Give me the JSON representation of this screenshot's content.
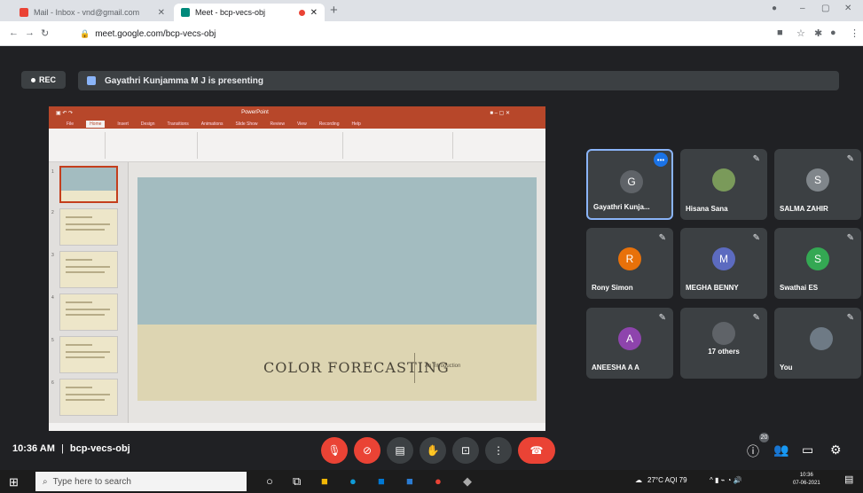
{
  "browser": {
    "tab_inactive": "Mail - Inbox - vnd@gmail.com",
    "tab_active": "Meet - bcp-vecs-obj",
    "url": "meet.google.com/bcp-vecs-obj"
  },
  "meet": {
    "rec": "REC",
    "presenting_text": "Gayathri Kunjamma M J is presenting",
    "time": "10:36 AM",
    "separator": "|",
    "meeting_code": "bcp-vecs-obj",
    "people_badge": "20"
  },
  "slide": {
    "title": "COLOR FORECASTING",
    "subtitle": "An Introduction",
    "app_doc_title": "PowerPoint",
    "ribbon_tabs": [
      "File",
      "Home",
      "Insert",
      "Design",
      "Transitions",
      "Animations",
      "Slide Show",
      "Review",
      "View",
      "Recording",
      "Help"
    ]
  },
  "participants": [
    {
      "initial": "G",
      "name": "Gayathri Kunja...",
      "color": "#5f6368"
    },
    {
      "initial": "",
      "name": "Hisana Sana",
      "color": "#7a9a5a"
    },
    {
      "initial": "S",
      "name": "SALMA ZAHIR",
      "color": "#80868b"
    },
    {
      "initial": "R",
      "name": "Rony Simon",
      "color": "#e8710a"
    },
    {
      "initial": "M",
      "name": "MEGHA BENNY",
      "color": "#5c6bc0"
    },
    {
      "initial": "S",
      "name": "Swathai ES",
      "color": "#34a853"
    },
    {
      "initial": "A",
      "name": "ANEESHA A A",
      "color": "#8e44ad"
    },
    {
      "initial": "",
      "name": "17 others",
      "color": "#5f6368"
    },
    {
      "initial": "",
      "name": "You",
      "color": "#5f6368"
    }
  ],
  "taskbar": {
    "search_placeholder": "Type here to search",
    "weather": "27°C  AQI 79",
    "clock_time": "10:36",
    "clock_date": "07-06-2021"
  }
}
